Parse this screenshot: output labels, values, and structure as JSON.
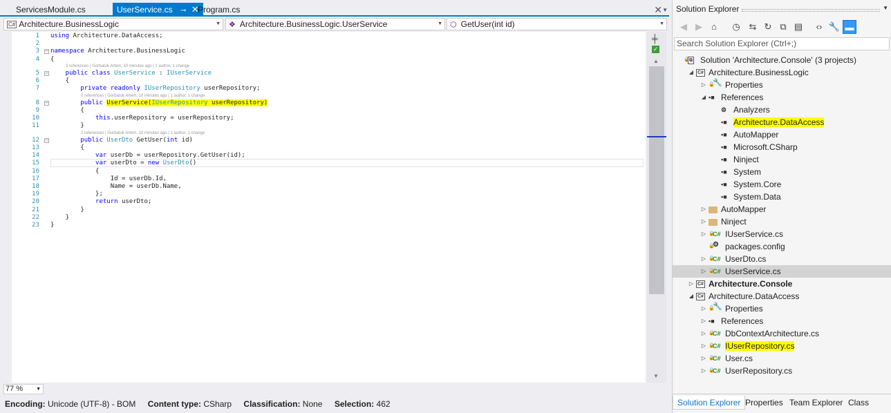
{
  "tabs": [
    {
      "label": "ServicesModule.cs",
      "active": false
    },
    {
      "label": "UserService.cs",
      "active": true
    },
    {
      "label": "Program.cs",
      "active": false
    }
  ],
  "tab_icons": {
    "pin": "pin-icon",
    "close": "close-icon",
    "close_all": "close-icon",
    "dropdown": "chevron-down-icon"
  },
  "navbar": {
    "project": "Architecture.BusinessLogic",
    "type": "Architecture.BusinessLogic.UserService",
    "member": "GetUser(int id)",
    "project_icon": "C#"
  },
  "code": {
    "lines": [
      {
        "n": "1",
        "segs": [
          {
            "t": "using ",
            "c": "kw"
          },
          {
            "t": "Architecture.DataAccess;"
          }
        ]
      },
      {
        "n": "2",
        "segs": []
      },
      {
        "n": "3",
        "fold": "−",
        "segs": [
          {
            "t": "namespace ",
            "c": "kw"
          },
          {
            "t": "Architecture.BusinessLogic"
          }
        ]
      },
      {
        "n": "4",
        "segs": [
          {
            "t": "{"
          }
        ]
      },
      {
        "n": "5",
        "fold": "−",
        "segs": [
          {
            "t": "    public class ",
            "c": "kw"
          },
          {
            "t": "UserService",
            "c": "ty"
          },
          {
            "t": " : "
          },
          {
            "t": "IUserService",
            "c": "ty"
          }
        ]
      },
      {
        "n": "6",
        "segs": [
          {
            "t": "    {"
          }
        ]
      },
      {
        "n": "7",
        "segs": [
          {
            "t": "        private readonly ",
            "c": "kw"
          },
          {
            "t": "IUserRepository",
            "c": "ty"
          },
          {
            "t": " userRepository;"
          }
        ]
      },
      {
        "n": "8",
        "fold": "−",
        "segs": [
          {
            "t": "        public ",
            "c": "kw"
          },
          {
            "t": "UserService(",
            "h": true
          },
          {
            "t": "IUserRepository",
            "c": "ty",
            "h": true
          },
          {
            "t": " userRepository)",
            "h": true
          }
        ]
      },
      {
        "n": "9",
        "segs": [
          {
            "t": "        {"
          }
        ]
      },
      {
        "n": "10",
        "segs": [
          {
            "t": "            this",
            "c": "kw"
          },
          {
            "t": ".userRepository = userRepository;"
          }
        ]
      },
      {
        "n": "11",
        "segs": [
          {
            "t": "        }"
          }
        ]
      },
      {
        "n": "12",
        "fold": "−",
        "segs": [
          {
            "t": "        public ",
            "c": "kw"
          },
          {
            "t": "UserDto",
            "c": "ty"
          },
          {
            "t": " GetUser("
          },
          {
            "t": "int",
            "c": "kw"
          },
          {
            "t": " id)"
          }
        ]
      },
      {
        "n": "13",
        "segs": [
          {
            "t": "        {"
          }
        ]
      },
      {
        "n": "14",
        "segs": [
          {
            "t": "            var ",
            "c": "kw"
          },
          {
            "t": "userDb = userRepository.GetUser(id);"
          }
        ]
      },
      {
        "n": "15",
        "segs": [
          {
            "t": "            var ",
            "c": "kw"
          },
          {
            "t": "userDto = "
          },
          {
            "t": "new ",
            "c": "kw"
          },
          {
            "t": "UserDto",
            "c": "ty"
          },
          {
            "t": "()"
          }
        ]
      },
      {
        "n": "16",
        "segs": [
          {
            "t": "            {"
          }
        ]
      },
      {
        "n": "17",
        "segs": [
          {
            "t": "                Id = userDb.Id,"
          }
        ]
      },
      {
        "n": "18",
        "segs": [
          {
            "t": "                Name = userDb.Name,"
          }
        ]
      },
      {
        "n": "19",
        "segs": [
          {
            "t": "            };"
          }
        ]
      },
      {
        "n": "20",
        "segs": [
          {
            "t": "            return ",
            "c": "kw"
          },
          {
            "t": "userDto;"
          }
        ]
      },
      {
        "n": "21",
        "segs": [
          {
            "t": "        }"
          }
        ]
      },
      {
        "n": "22",
        "segs": [
          {
            "t": "    }"
          }
        ]
      },
      {
        "n": "23",
        "segs": [
          {
            "t": "}"
          }
        ]
      }
    ],
    "lens": [
      {
        "before": "5",
        "text": "3 references | Gorbatuk Artem, 10 minutes ago | 1 author, 1 change"
      },
      {
        "before": "8",
        "text": "0 references | Gorbatuk Artem, 10 minutes ago | 1 author, 1 change"
      },
      {
        "before": "12",
        "text": "2 references | Gorbatuk Artem, 10 minutes ago | 1 author, 1 change"
      }
    ]
  },
  "zoom": "77 %",
  "status": {
    "encoding_label": "Encoding:",
    "encoding": "Unicode (UTF-8) - BOM",
    "content_label": "Content type:",
    "content": "CSharp",
    "class_label": "Classification:",
    "class": "None",
    "selection_label": "Selection:",
    "selection": "462"
  },
  "solution_explorer": {
    "title": "Solution Explorer",
    "search_placeholder": "Search Solution Explorer (Ctrl+;)",
    "toolbar_icons": [
      "back-icon",
      "forward-icon",
      "home-icon",
      "history-icon",
      "sync-icon",
      "refresh-icon",
      "collapse-all-icon",
      "show-files-icon",
      "code-view-icon",
      "properties-icon",
      "preview-icon"
    ],
    "tree": [
      {
        "label": "Solution 'Architecture.Console' (3 projects)",
        "level": 0,
        "icon": "sln",
        "exp": "",
        "lock": true
      },
      {
        "label": "Architecture.BusinessLogic",
        "level": 1,
        "icon": "proj",
        "exp": "◢",
        "lock": false
      },
      {
        "label": "Properties",
        "level": 2,
        "icon": "wrench",
        "exp": "▷",
        "lock": true
      },
      {
        "label": "References",
        "level": 2,
        "icon": "ref",
        "exp": "◢",
        "lock": false
      },
      {
        "label": "Analyzers",
        "level": 3,
        "icon": "analyzer",
        "exp": "",
        "lock": false
      },
      {
        "label": "Architecture.DataAccess",
        "level": 3,
        "icon": "ref",
        "exp": "",
        "lock": false,
        "highlight": true
      },
      {
        "label": "AutoMapper",
        "level": 3,
        "icon": "ref",
        "exp": "",
        "lock": false
      },
      {
        "label": "Microsoft.CSharp",
        "level": 3,
        "icon": "ref",
        "exp": "",
        "lock": false
      },
      {
        "label": "Ninject",
        "level": 3,
        "icon": "ref",
        "exp": "",
        "lock": false
      },
      {
        "label": "System",
        "level": 3,
        "icon": "ref",
        "exp": "",
        "lock": false
      },
      {
        "label": "System.Core",
        "level": 3,
        "icon": "ref",
        "exp": "",
        "lock": false
      },
      {
        "label": "System.Data",
        "level": 3,
        "icon": "ref",
        "exp": "",
        "lock": false
      },
      {
        "label": "AutoMapper",
        "level": 2,
        "icon": "folder",
        "exp": "▷",
        "lock": false
      },
      {
        "label": "Ninject",
        "level": 2,
        "icon": "folder",
        "exp": "▷",
        "lock": false
      },
      {
        "label": "IUserService.cs",
        "level": 2,
        "icon": "cs",
        "exp": "▷",
        "lock": true
      },
      {
        "label": "packages.config",
        "level": 2,
        "icon": "cfg",
        "exp": "",
        "lock": true
      },
      {
        "label": "UserDto.cs",
        "level": 2,
        "icon": "cs",
        "exp": "▷",
        "lock": true
      },
      {
        "label": "UserService.cs",
        "level": 2,
        "icon": "cs",
        "exp": "▷",
        "lock": true,
        "selected": true
      },
      {
        "label": "Architecture.Console",
        "level": 1,
        "icon": "proj",
        "exp": "▷",
        "lock": false,
        "bold": true
      },
      {
        "label": "Architecture.DataAccess",
        "level": 1,
        "icon": "proj",
        "exp": "◢",
        "lock": false
      },
      {
        "label": "Properties",
        "level": 2,
        "icon": "wrench",
        "exp": "▷",
        "lock": true
      },
      {
        "label": "References",
        "level": 2,
        "icon": "ref",
        "exp": "▷",
        "lock": false
      },
      {
        "label": "DbContextArchitecture.cs",
        "level": 2,
        "icon": "cs",
        "exp": "▷",
        "lock": true
      },
      {
        "label": "IUserRepository.cs",
        "level": 2,
        "icon": "cs",
        "exp": "▷",
        "lock": true,
        "highlight": true
      },
      {
        "label": "User.cs",
        "level": 2,
        "icon": "cs",
        "exp": "▷",
        "lock": true
      },
      {
        "label": "UserRepository.cs",
        "level": 2,
        "icon": "cs",
        "exp": "▷",
        "lock": true
      }
    ],
    "bottom_tabs": [
      {
        "label": "Solution Explorer",
        "active": true
      },
      {
        "label": "Properties",
        "active": false
      },
      {
        "label": "Team Explorer",
        "active": false
      },
      {
        "label": "Class View",
        "active": false
      }
    ]
  },
  "colors": {
    "accent": "#007acc",
    "highlight": "#ffff00",
    "keyword": "#0000ff",
    "type": "#2b91af",
    "line_number": "#2b91af"
  }
}
